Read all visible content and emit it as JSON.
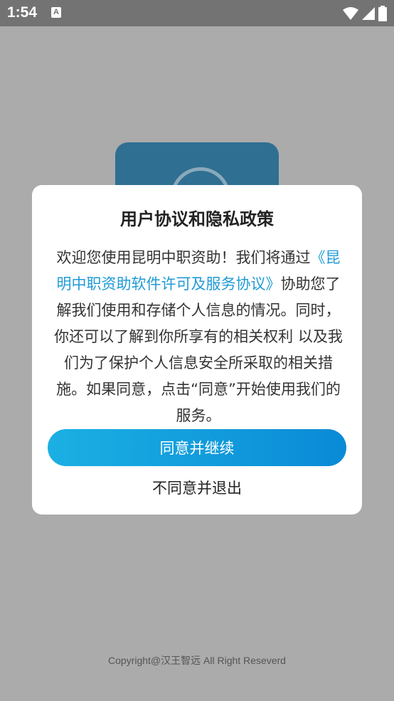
{
  "status_bar": {
    "time": "1:54",
    "notification_icon": "text-a-icon",
    "icons": [
      "wifi-icon",
      "signal-icon",
      "battery-icon"
    ]
  },
  "dialog": {
    "title": "用户协议和隐私政策",
    "body_before_link": "欢迎您使用昆明中职资助！我们将通过",
    "link_text": "《昆明中职资助软件许可及服务协议》",
    "body_after_link": "协助您了解我们使用和存储个人信息的情况。同时，你还可以了解到你所享有的相关权利 以及我们为了保护个人信息安全所采取的相关措施。如果同意，点击“同意”开始使用我们的服务。",
    "agree_button": "同意并继续",
    "decline_button": "不同意并退出"
  },
  "footer": {
    "copyright": "Copyright@汉王智远 All Right Reseverd"
  },
  "colors": {
    "status_bar": "#737373",
    "backdrop": "#ababab",
    "link": "#1f9ad6",
    "button_start": "#1bb0e3",
    "button_end": "#0a8ad6",
    "logo": "#2f6f92"
  }
}
